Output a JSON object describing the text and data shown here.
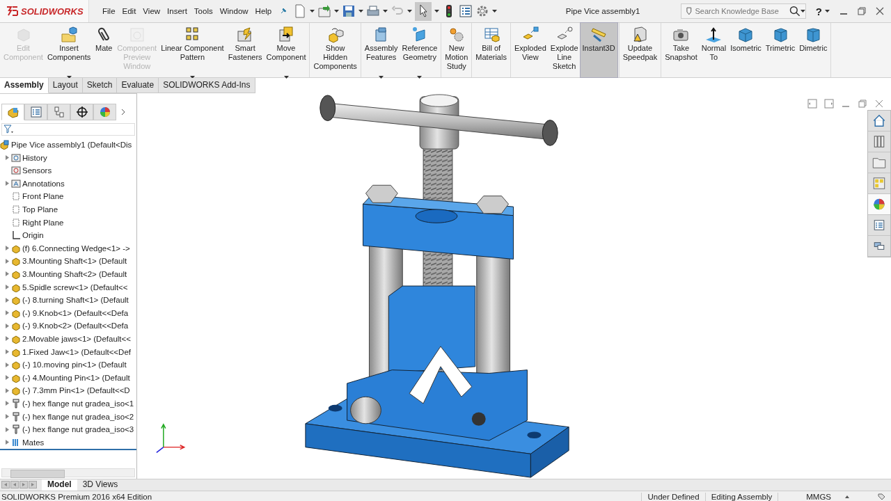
{
  "app": {
    "logo_text": "SOLIDWORKS",
    "menu": [
      "File",
      "Edit",
      "View",
      "Insert",
      "Tools",
      "Window",
      "Help"
    ],
    "title": "Pipe Vice assembly1",
    "search": {
      "placeholder": "Search Knowledge Base"
    },
    "help_label": "?"
  },
  "ribbon": {
    "groups": [
      {
        "buttons": [
          {
            "label": "Edit\nComponent",
            "disabled": true,
            "dropdown": false,
            "selected": false
          },
          {
            "label": "Insert\nComponents",
            "disabled": false,
            "dropdown": true,
            "selected": false
          },
          {
            "label": "Mate",
            "disabled": false,
            "dropdown": false,
            "selected": false
          },
          {
            "label": "Component\nPreview\nWindow",
            "disabled": true,
            "dropdown": false,
            "selected": false
          },
          {
            "label": "Linear Component\nPattern",
            "disabled": false,
            "dropdown": true,
            "selected": false
          },
          {
            "label": "Smart\nFasteners",
            "disabled": false,
            "dropdown": false,
            "selected": false
          },
          {
            "label": "Move\nComponent",
            "disabled": false,
            "dropdown": true,
            "selected": false
          }
        ]
      },
      {
        "buttons": [
          {
            "label": "Show\nHidden\nComponents",
            "disabled": false,
            "dropdown": false,
            "selected": false
          }
        ]
      },
      {
        "buttons": [
          {
            "label": "Assembly\nFeatures",
            "disabled": false,
            "dropdown": true,
            "selected": false
          },
          {
            "label": "Reference\nGeometry",
            "disabled": false,
            "dropdown": true,
            "selected": false
          }
        ]
      },
      {
        "buttons": [
          {
            "label": "New\nMotion\nStudy",
            "disabled": false,
            "dropdown": false,
            "selected": false
          }
        ]
      },
      {
        "buttons": [
          {
            "label": "Bill of\nMaterials",
            "disabled": false,
            "dropdown": false,
            "selected": false
          }
        ]
      },
      {
        "buttons": [
          {
            "label": "Exploded\nView",
            "disabled": false,
            "dropdown": false,
            "selected": false
          },
          {
            "label": "Explode\nLine\nSketch",
            "disabled": false,
            "dropdown": false,
            "selected": false
          },
          {
            "label": "Instant3D",
            "disabled": false,
            "dropdown": false,
            "selected": true
          }
        ]
      },
      {
        "buttons": [
          {
            "label": "Update\nSpeedpak",
            "disabled": false,
            "dropdown": false,
            "selected": false
          }
        ]
      },
      {
        "buttons": [
          {
            "label": "Take\nSnapshot",
            "disabled": false,
            "dropdown": false,
            "selected": false
          },
          {
            "label": "Normal\nTo",
            "disabled": false,
            "dropdown": false,
            "selected": false
          },
          {
            "label": "Isometric",
            "disabled": false,
            "dropdown": false,
            "selected": false
          },
          {
            "label": "Trimetric",
            "disabled": false,
            "dropdown": false,
            "selected": false
          },
          {
            "label": "Dimetric",
            "disabled": false,
            "dropdown": false,
            "selected": false
          }
        ]
      }
    ]
  },
  "command_tabs": [
    {
      "label": "Assembly",
      "selected": true
    },
    {
      "label": "Layout",
      "selected": false
    },
    {
      "label": "Sketch",
      "selected": false
    },
    {
      "label": "Evaluate",
      "selected": false
    },
    {
      "label": "SOLIDWORKS Add-Ins",
      "selected": false
    }
  ],
  "feature_tree": {
    "root": {
      "label": "Pipe Vice assembly1  (Default<Dis",
      "children": [
        {
          "label": "History",
          "kind": "history",
          "expandable": true
        },
        {
          "label": "Sensors",
          "kind": "sensors",
          "expandable": false
        },
        {
          "label": "Annotations",
          "kind": "annotations",
          "expandable": true
        },
        {
          "label": "Front Plane",
          "kind": "plane",
          "expandable": false
        },
        {
          "label": "Top Plane",
          "kind": "plane",
          "expandable": false
        },
        {
          "label": "Right Plane",
          "kind": "plane",
          "expandable": false
        },
        {
          "label": "Origin",
          "kind": "origin",
          "expandable": false
        },
        {
          "label": "(f) 6.Connecting Wedge<1> ->",
          "kind": "part",
          "expandable": true
        },
        {
          "label": "3.Mounting Shaft<1> (Default",
          "kind": "part",
          "expandable": true
        },
        {
          "label": "3.Mounting Shaft<2> (Default",
          "kind": "part",
          "expandable": true
        },
        {
          "label": "5.Spidle screw<1> (Default<<",
          "kind": "part",
          "expandable": true
        },
        {
          "label": "(-) 8.turning Shaft<1> (Default",
          "kind": "part",
          "expandable": true
        },
        {
          "label": "(-) 9.Knob<1> (Default<<Defa",
          "kind": "part",
          "expandable": true
        },
        {
          "label": "(-) 9.Knob<2> (Default<<Defa",
          "kind": "part",
          "expandable": true
        },
        {
          "label": "2.Movable jaws<1> (Default<<",
          "kind": "part",
          "expandable": true
        },
        {
          "label": "1.Fixed Jaw<1> (Default<<Def",
          "kind": "part",
          "expandable": true
        },
        {
          "label": "(-) 10.moving pin<1> (Default",
          "kind": "part",
          "expandable": true
        },
        {
          "label": "(-) 4.Mounting Pin<1> (Default",
          "kind": "part",
          "expandable": true
        },
        {
          "label": "(-) 7.3mm Pin<1> (Default<<D",
          "kind": "part",
          "expandable": true
        },
        {
          "label": "(-) hex flange nut gradea_iso<1",
          "kind": "fastener",
          "expandable": true
        },
        {
          "label": "(-) hex flange nut gradea_iso<2",
          "kind": "fastener",
          "expandable": true
        },
        {
          "label": "(-) hex flange nut gradea_iso<3",
          "kind": "fastener",
          "expandable": true
        },
        {
          "label": "Mates",
          "kind": "mates",
          "expandable": true
        }
      ]
    }
  },
  "bottom_tabs": [
    {
      "label": "Model",
      "selected": true
    },
    {
      "label": "3D Views",
      "selected": false
    }
  ],
  "status_bar": {
    "edition": "SOLIDWORKS Premium 2016 x64 Edition",
    "state": "Under Defined",
    "mode": "Editing Assembly",
    "units": "MMGS"
  }
}
